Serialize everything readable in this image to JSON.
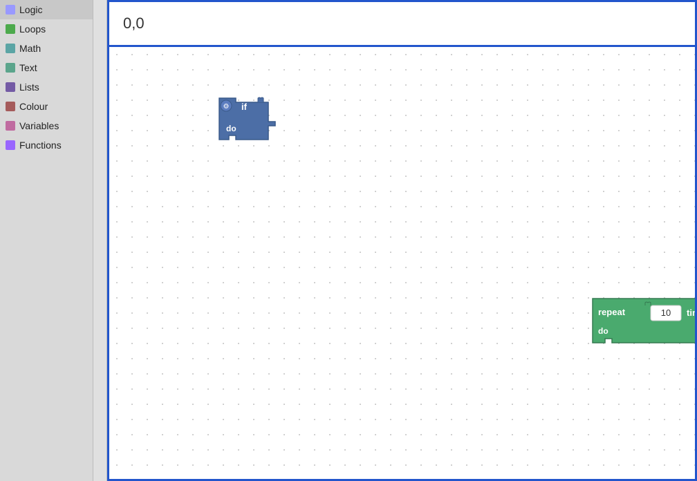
{
  "sidebar": {
    "items": [
      {
        "label": "Logic",
        "color": "#9999ff",
        "id": "logic"
      },
      {
        "label": "Loops",
        "color": "#4daa4d",
        "id": "loops"
      },
      {
        "label": "Math",
        "color": "#5ba5a5",
        "id": "math"
      },
      {
        "label": "Text",
        "color": "#5ba58c",
        "id": "text"
      },
      {
        "label": "Lists",
        "color": "#745ba5",
        "id": "lists"
      },
      {
        "label": "Colour",
        "color": "#a55b5b",
        "id": "colour"
      },
      {
        "label": "Variables",
        "color": "#c06ba0",
        "id": "variables"
      },
      {
        "label": "Functions",
        "color": "#9966ff",
        "id": "functions"
      }
    ]
  },
  "coords": {
    "display": "0,0"
  },
  "blocks": {
    "if_block": {
      "label_if": "if",
      "label_do": "do"
    },
    "repeat_block": {
      "label_repeat": "repeat",
      "label_times": "times",
      "label_do": "do",
      "value": "10"
    }
  },
  "icons": {
    "gear": "⚙"
  }
}
